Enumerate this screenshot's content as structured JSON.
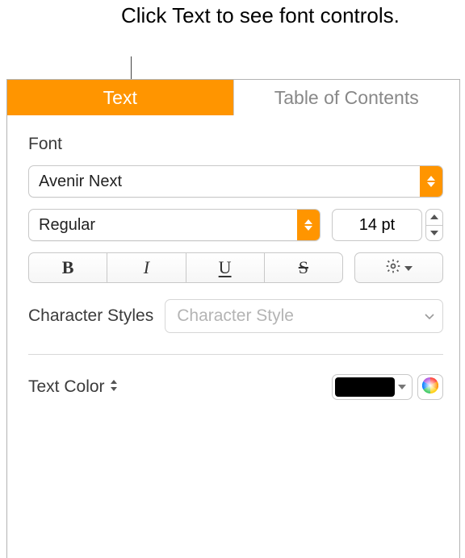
{
  "callout": "Click Text to see font controls.",
  "tabs": {
    "text": "Text",
    "toc": "Table of Contents"
  },
  "font": {
    "section": "Font",
    "family": "Avenir Next",
    "style": "Regular",
    "size": "14 pt",
    "buttons": {
      "bold": "B",
      "italic": "I",
      "underline": "U",
      "strike": "S"
    }
  },
  "charstyles": {
    "label": "Character Styles",
    "placeholder": "Character Style"
  },
  "textcolor": {
    "label": "Text Color",
    "value": "#000000"
  }
}
